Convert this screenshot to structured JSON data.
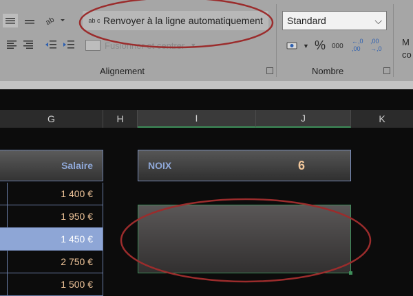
{
  "ribbon": {
    "wrap_text_label": "Renvoyer à la ligne automatiquement",
    "wrap_icon_text": "ab c",
    "merge_label": "Fusionner et centrer",
    "alignment_group_label": "Alignement",
    "number_group_label": "Nombre",
    "number_format_value": "Standard",
    "percent_symbol": "%",
    "thousands_symbol": "000",
    "increase_decimal": "←,0 ,00",
    "decrease_decimal": ",00 →,0",
    "cut_text_top": "M",
    "cut_text_bottom": "co"
  },
  "columns": [
    {
      "label": "G"
    },
    {
      "label": "H"
    },
    {
      "label": "I"
    },
    {
      "label": "J"
    },
    {
      "label": "K"
    }
  ],
  "table": {
    "header": "Salaire",
    "rows": [
      "1 400 €",
      "1 950 €",
      "1 450 €",
      "2 750 €",
      "1 500 €"
    ]
  },
  "noix": {
    "label": "NOIX",
    "value": "6"
  },
  "colors": {
    "annotation": "#9b2c2c",
    "selection_green": "#3e8f5a",
    "highlight_row": "#8ea6d6",
    "value_text": "#f2c79b"
  }
}
